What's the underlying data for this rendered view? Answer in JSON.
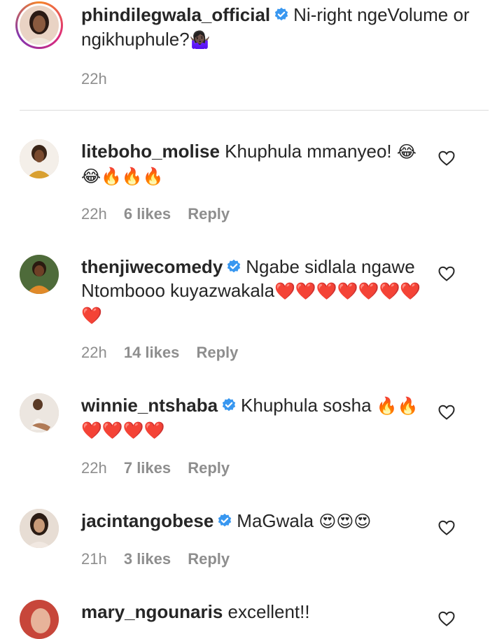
{
  "caption": {
    "username": "phindilegwala_official",
    "text": "Ni-right ngeVolume or ngikhuphule?",
    "emoji": "🤷🏿‍♀️",
    "time": "22h"
  },
  "comments": [
    {
      "username": "liteboho_molise",
      "verified": false,
      "text": "Khuphula mmanyeo!",
      "emoji": "😂😂🔥🔥🔥",
      "time": "22h",
      "likes": "6 likes",
      "reply": "Reply"
    },
    {
      "username": "thenjiwecomedy",
      "verified": true,
      "text": "Ngabe sidlala ngawe Ntombooo kuyazwakala",
      "emoji": "❤️❤️❤️❤️❤️❤️❤️❤️",
      "time": "22h",
      "likes": "14 likes",
      "reply": "Reply"
    },
    {
      "username": "winnie_ntshaba",
      "verified": true,
      "text": "Khuphula sosha",
      "emoji": "🔥🔥❤️❤️❤️❤️",
      "time": "22h",
      "likes": "7 likes",
      "reply": "Reply"
    },
    {
      "username": "jacintangobese",
      "verified": true,
      "text": "MaGwala",
      "emoji": "😍😍😍",
      "time": "21h",
      "likes": "3 likes",
      "reply": "Reply"
    },
    {
      "username": "mary_ngounaris",
      "verified": false,
      "text": "excellent!!",
      "emoji": "",
      "time": "",
      "likes": "",
      "reply": ""
    }
  ],
  "colors": {
    "verified_blue": "#3897f0",
    "meta_gray": "#8e8e8e",
    "text": "#262626"
  },
  "icons": {
    "verified": "verified-badge-icon",
    "like": "heart-outline-icon"
  }
}
